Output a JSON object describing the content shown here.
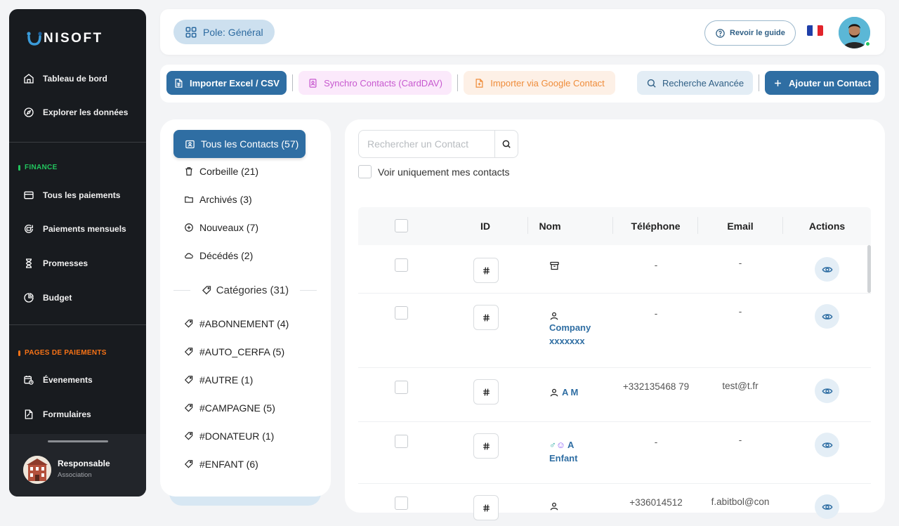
{
  "brand": {
    "logo_text": "NISOFT",
    "logo_icon": "unisoft-u-logo"
  },
  "sidebar": {
    "items_top": [
      {
        "label": "Tableau de bord",
        "icon": "home-icon"
      },
      {
        "label": "Explorer les données",
        "icon": "compass-icon"
      }
    ],
    "section_finance": {
      "label": "FINANCE",
      "color": "#22c55e"
    },
    "items_finance": [
      {
        "label": "Tous les paiements",
        "icon": "credit-card-icon"
      },
      {
        "label": "Paiements mensuels",
        "icon": "refresh-card-icon"
      },
      {
        "label": "Promesses",
        "icon": "hourglass-icon"
      },
      {
        "label": "Budget",
        "icon": "pie-chart-icon"
      }
    ],
    "section_pages": {
      "label": "PAGES DE PAIEMENTS",
      "color": "#f97316"
    },
    "items_pages": [
      {
        "label": "Évenements",
        "icon": "calendar-clock-icon"
      },
      {
        "label": "Formulaires",
        "icon": "form-icon"
      }
    ],
    "user": {
      "name": "Responsable",
      "role": "Association"
    }
  },
  "topbar": {
    "pole_label": "Pole: Général",
    "guide_label": "Revoir le guide",
    "language": "fr-flag-icon"
  },
  "toolbar": {
    "import_excel": "Importer Excel / CSV",
    "sync_contacts": "Synchro Contacts (CardDAV)",
    "import_google": "Importer via Google Contact",
    "advanced_search": "Recherche Avancée",
    "add_contact": "Ajouter un Contact"
  },
  "filters": {
    "all_contacts": "Tous les Contacts (57)",
    "trash": "Corbeille (21)",
    "archived": "Archivés (3)",
    "new": "Nouveaux (7)",
    "deceased": "Décédés (2)",
    "categories_title": "Catégories (31)",
    "categories": [
      "#ABONNEMENT (4)",
      "#AUTO_CERFA (5)",
      "#AUTRE (1)",
      "#CAMPAGNE (5)",
      "#DONATEUR (1)",
      "#ENFANT (6)"
    ]
  },
  "main": {
    "search_placeholder": "Rechercher un Contact",
    "only_mine_label": "Voir uniquement mes contacts",
    "columns": {
      "id": "ID",
      "name": "Nom",
      "phone": "Téléphone",
      "email": "Email",
      "actions": "Actions"
    },
    "rows": [
      {
        "name": "",
        "name_icon": "archive-icon",
        "phone": "-",
        "email": "-"
      },
      {
        "name": "Company xxxxxxx",
        "name_icon": "person-icon",
        "phone": "-",
        "email": "-"
      },
      {
        "name": "A M",
        "name_icon": "person-icon",
        "phone": "+332135468 79",
        "email": "test@t.fr"
      },
      {
        "name": "A Enfant",
        "name_icon": "male-child-icon",
        "phone": "-",
        "email": "-"
      },
      {
        "name": "",
        "name_icon": "person-icon",
        "phone": "+336014512",
        "email": "f.abitbol@con"
      }
    ]
  },
  "colors": {
    "primary": "#2f6ea3",
    "sidebar_bg": "#181b1f",
    "sync_bg": "#fbe9fb",
    "sync_text": "#c759cf",
    "google_bg": "#fdf0e6",
    "google_text": "#ef8c3a"
  }
}
